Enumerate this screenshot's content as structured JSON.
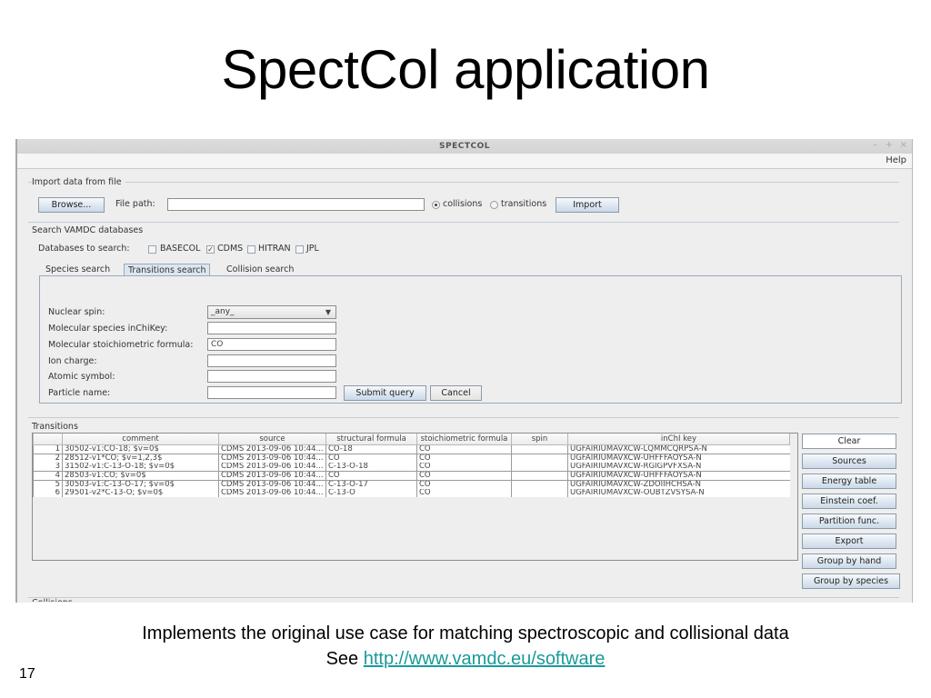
{
  "slide": {
    "title": "SpectCol application",
    "caption_line1": "Implements the original use case for matching spectroscopic and collisional data",
    "caption_prefix": "See ",
    "caption_link": "http://www.vamdc.eu/software",
    "page_number": "17"
  },
  "window": {
    "title": "SPECTCOL",
    "controls": [
      "–",
      "+",
      "×"
    ],
    "menu": [
      "Help"
    ]
  },
  "import": {
    "group_title": "Import data from file",
    "browse_label": "Browse...",
    "file_path_label": "File path:",
    "file_path_value": "",
    "radio_options": [
      {
        "label": "collisions",
        "selected": true
      },
      {
        "label": "transitions",
        "selected": false
      }
    ],
    "import_label": "Import"
  },
  "search": {
    "group_title": "Search VAMDC databases",
    "databases_label": "Databases to search:",
    "databases": [
      {
        "label": "BASECOL",
        "checked": false
      },
      {
        "label": "CDMS",
        "checked": true
      },
      {
        "label": "HITRAN",
        "checked": false
      },
      {
        "label": "JPL",
        "checked": false
      }
    ],
    "tabs": [
      {
        "label": "Species search",
        "active": false
      },
      {
        "label": "Transitions search",
        "active": true
      },
      {
        "label": "Collision search",
        "active": false
      }
    ],
    "fields": [
      {
        "label": "Nuclear spin:",
        "type": "select",
        "value": "_any_"
      },
      {
        "label": "Molecular species inChiKey:",
        "type": "text",
        "value": ""
      },
      {
        "label": "Molecular stoichiometric formula:",
        "type": "text",
        "value": "CO"
      },
      {
        "label": "Ion charge:",
        "type": "text",
        "value": ""
      },
      {
        "label": "Atomic symbol:",
        "type": "text",
        "value": ""
      },
      {
        "label": "Particle name:",
        "type": "text",
        "value": ""
      }
    ],
    "submit_label": "Submit query",
    "cancel_label": "Cancel"
  },
  "transitions": {
    "group_title": "Transitions",
    "columns": [
      "",
      "comment",
      "source",
      "structural formula",
      "stoichiometric formula",
      "spin",
      "inChI key"
    ],
    "rows": [
      [
        "1",
        "30502-v1:CO-18; $v=0$",
        "CDMS 2013-09-06 10:44...",
        "CO-18",
        "CO",
        "",
        "UGFAIRIUMAVXCW-LQMMCQRPSA-N"
      ],
      [
        "2",
        "28512-v1*CO; $v=1,2,3$",
        "CDMS 2013-09-06 10:44...",
        "CO",
        "CO",
        "",
        "UGFAIRIUMAVXCW-UHFFFAOYSA-N"
      ],
      [
        "3",
        "31502-v1:C-13-O-18; $v=0$",
        "CDMS 2013-09-06 10:44...",
        "C-13-O-18",
        "CO",
        "",
        "UGFAIRIUMAVXCW-RGIGPVFXSA-N"
      ],
      [
        "4",
        "28503-v1:CO; $v=0$",
        "CDMS 2013-09-06 10:44...",
        "CO",
        "CO",
        "",
        "UGFAIRIUMAVXCW-UHFFFAOYSA-N"
      ],
      [
        "5",
        "30503-v1:C-13-O-17; $v=0$",
        "CDMS 2013-09-06 10:44...",
        "C-13-O-17",
        "CO",
        "",
        "UGFAIRIUMAVXCW-ZDOIIHCHSA-N"
      ],
      [
        "6",
        "29501-v2*C-13-O; $v=0$",
        "CDMS 2013-09-06 10:44...",
        "C-13-O",
        "CO",
        "",
        "UGFAIRIUMAVXCW-OUBTZVSYSA-N"
      ]
    ],
    "side_buttons": [
      "Clear",
      "Sources",
      "Energy table",
      "Einstein coef.",
      "Partition func.",
      "Export",
      "Group by hand",
      "Group by species"
    ]
  },
  "collisions": {
    "group_title": "Collisions"
  }
}
